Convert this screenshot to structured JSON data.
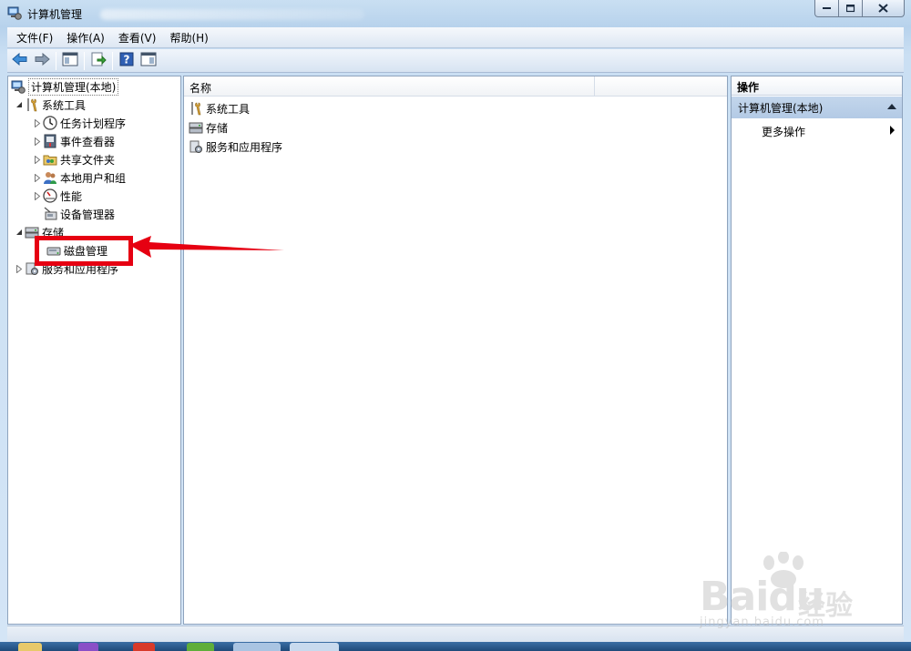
{
  "window": {
    "title": "计算机管理"
  },
  "menubar": {
    "items": [
      "文件(F)",
      "操作(A)",
      "查看(V)",
      "帮助(H)"
    ]
  },
  "toolbar": {
    "buttons": [
      "back-icon",
      "forward-icon",
      "show-hide-tree-icon",
      "export-list-icon",
      "help-icon",
      "show-hide-action-pane-icon"
    ]
  },
  "tree": {
    "root": "计算机管理(本地)",
    "system_tools": "系统工具",
    "task_scheduler": "任务计划程序",
    "event_viewer": "事件查看器",
    "shared_folders": "共享文件夹",
    "local_users_groups": "本地用户和组",
    "performance": "性能",
    "device_manager": "设备管理器",
    "storage": "存储",
    "disk_management": "磁盘管理",
    "services_apps": "服务和应用程序"
  },
  "list": {
    "column_name": "名称",
    "items": [
      "系统工具",
      "存储",
      "服务和应用程序"
    ]
  },
  "actions": {
    "header": "操作",
    "section": "计算机管理(本地)",
    "more": "更多操作"
  },
  "watermark": {
    "brand": "Bai",
    "brand_suffix": "du",
    "cn": "经验",
    "url": "jingyan.baidu.com"
  },
  "colors": {
    "highlight": "#e60012",
    "accent": "#b3cae5"
  }
}
